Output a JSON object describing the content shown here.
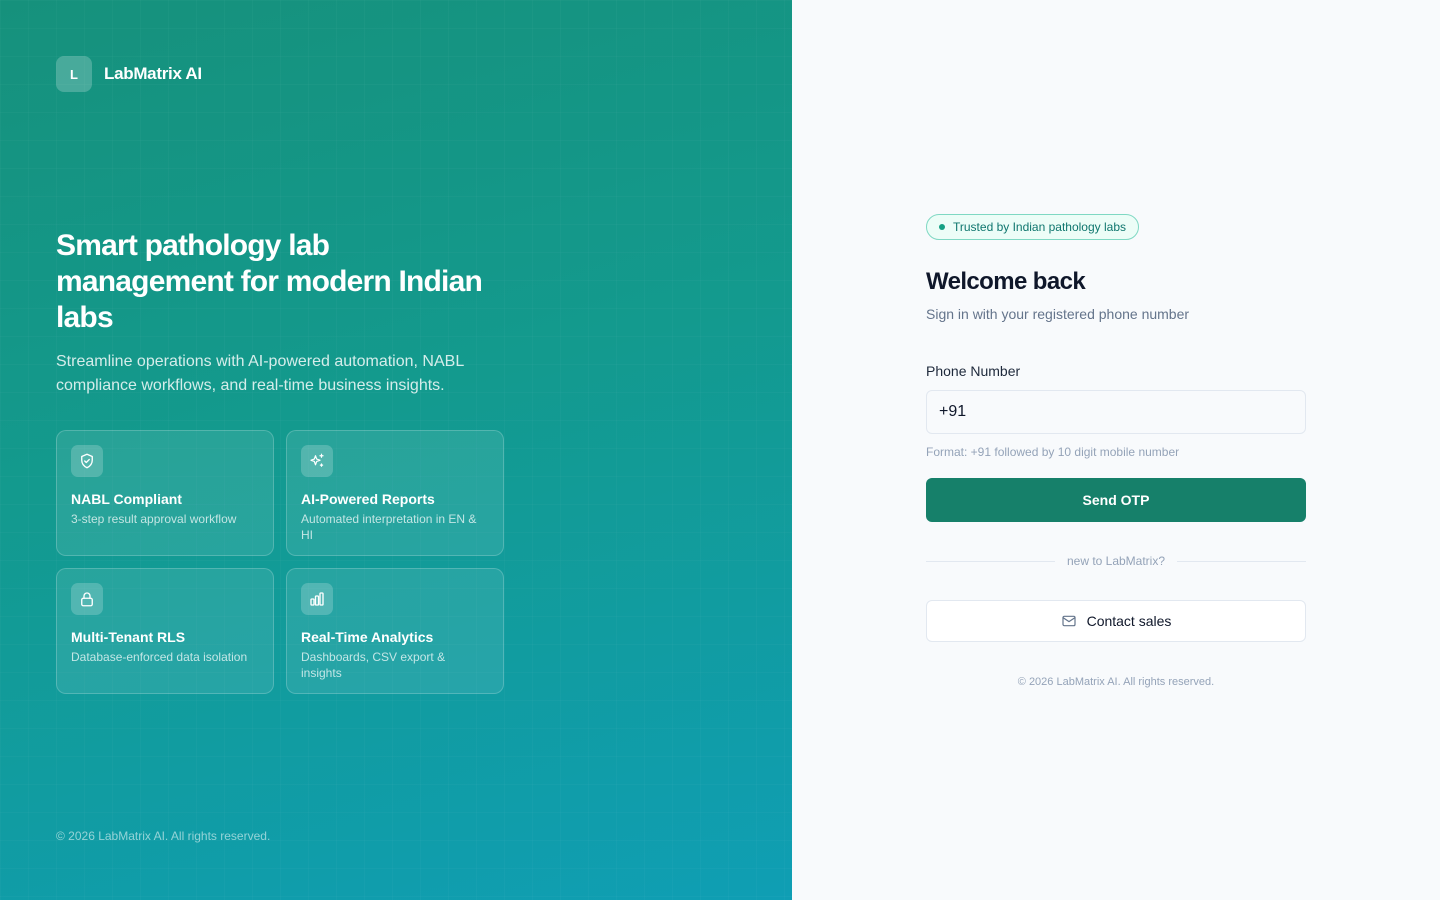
{
  "brand": {
    "logo_letter": "L",
    "name": "LabMatrix AI"
  },
  "hero": {
    "title": "Smart pathology lab management for modern Indian labs",
    "subtitle": "Streamline operations with AI-powered automation, NABL compliance workflows, and real-time business insights.",
    "features": [
      {
        "icon": "shield-check-icon",
        "title": "NABL Compliant",
        "description": "3-step result approval workflow"
      },
      {
        "icon": "sparkles-icon",
        "title": "AI-Powered Reports",
        "description": "Automated interpretation in EN & HI"
      },
      {
        "icon": "lock-icon",
        "title": "Multi-Tenant RLS",
        "description": "Database-enforced data isolation"
      },
      {
        "icon": "bar-chart-icon",
        "title": "Real-Time Analytics",
        "description": "Dashboards, CSV export & insights"
      }
    ],
    "footer": "© 2026 LabMatrix AI. All rights reserved."
  },
  "auth": {
    "badge": "Trusted by Indian pathology labs",
    "heading": "Welcome back",
    "subheading": "Sign in with your registered phone number",
    "phone_label": "Phone Number",
    "phone_value": "+91",
    "phone_hint": "Format: +91 followed by 10 digit mobile number",
    "submit_label": "Send OTP",
    "divider_text": "new to LabMatrix?",
    "contact_label": "Contact sales",
    "contact_icon": "mail-icon",
    "footer": "© 2026 LabMatrix AI. All rights reserved."
  },
  "colors": {
    "hero_gradient_start": "#16917c",
    "hero_gradient_end": "#0f9eb4",
    "primary_button": "#16806a",
    "badge_border": "#7fd8c3",
    "badge_text": "#0f766e"
  }
}
